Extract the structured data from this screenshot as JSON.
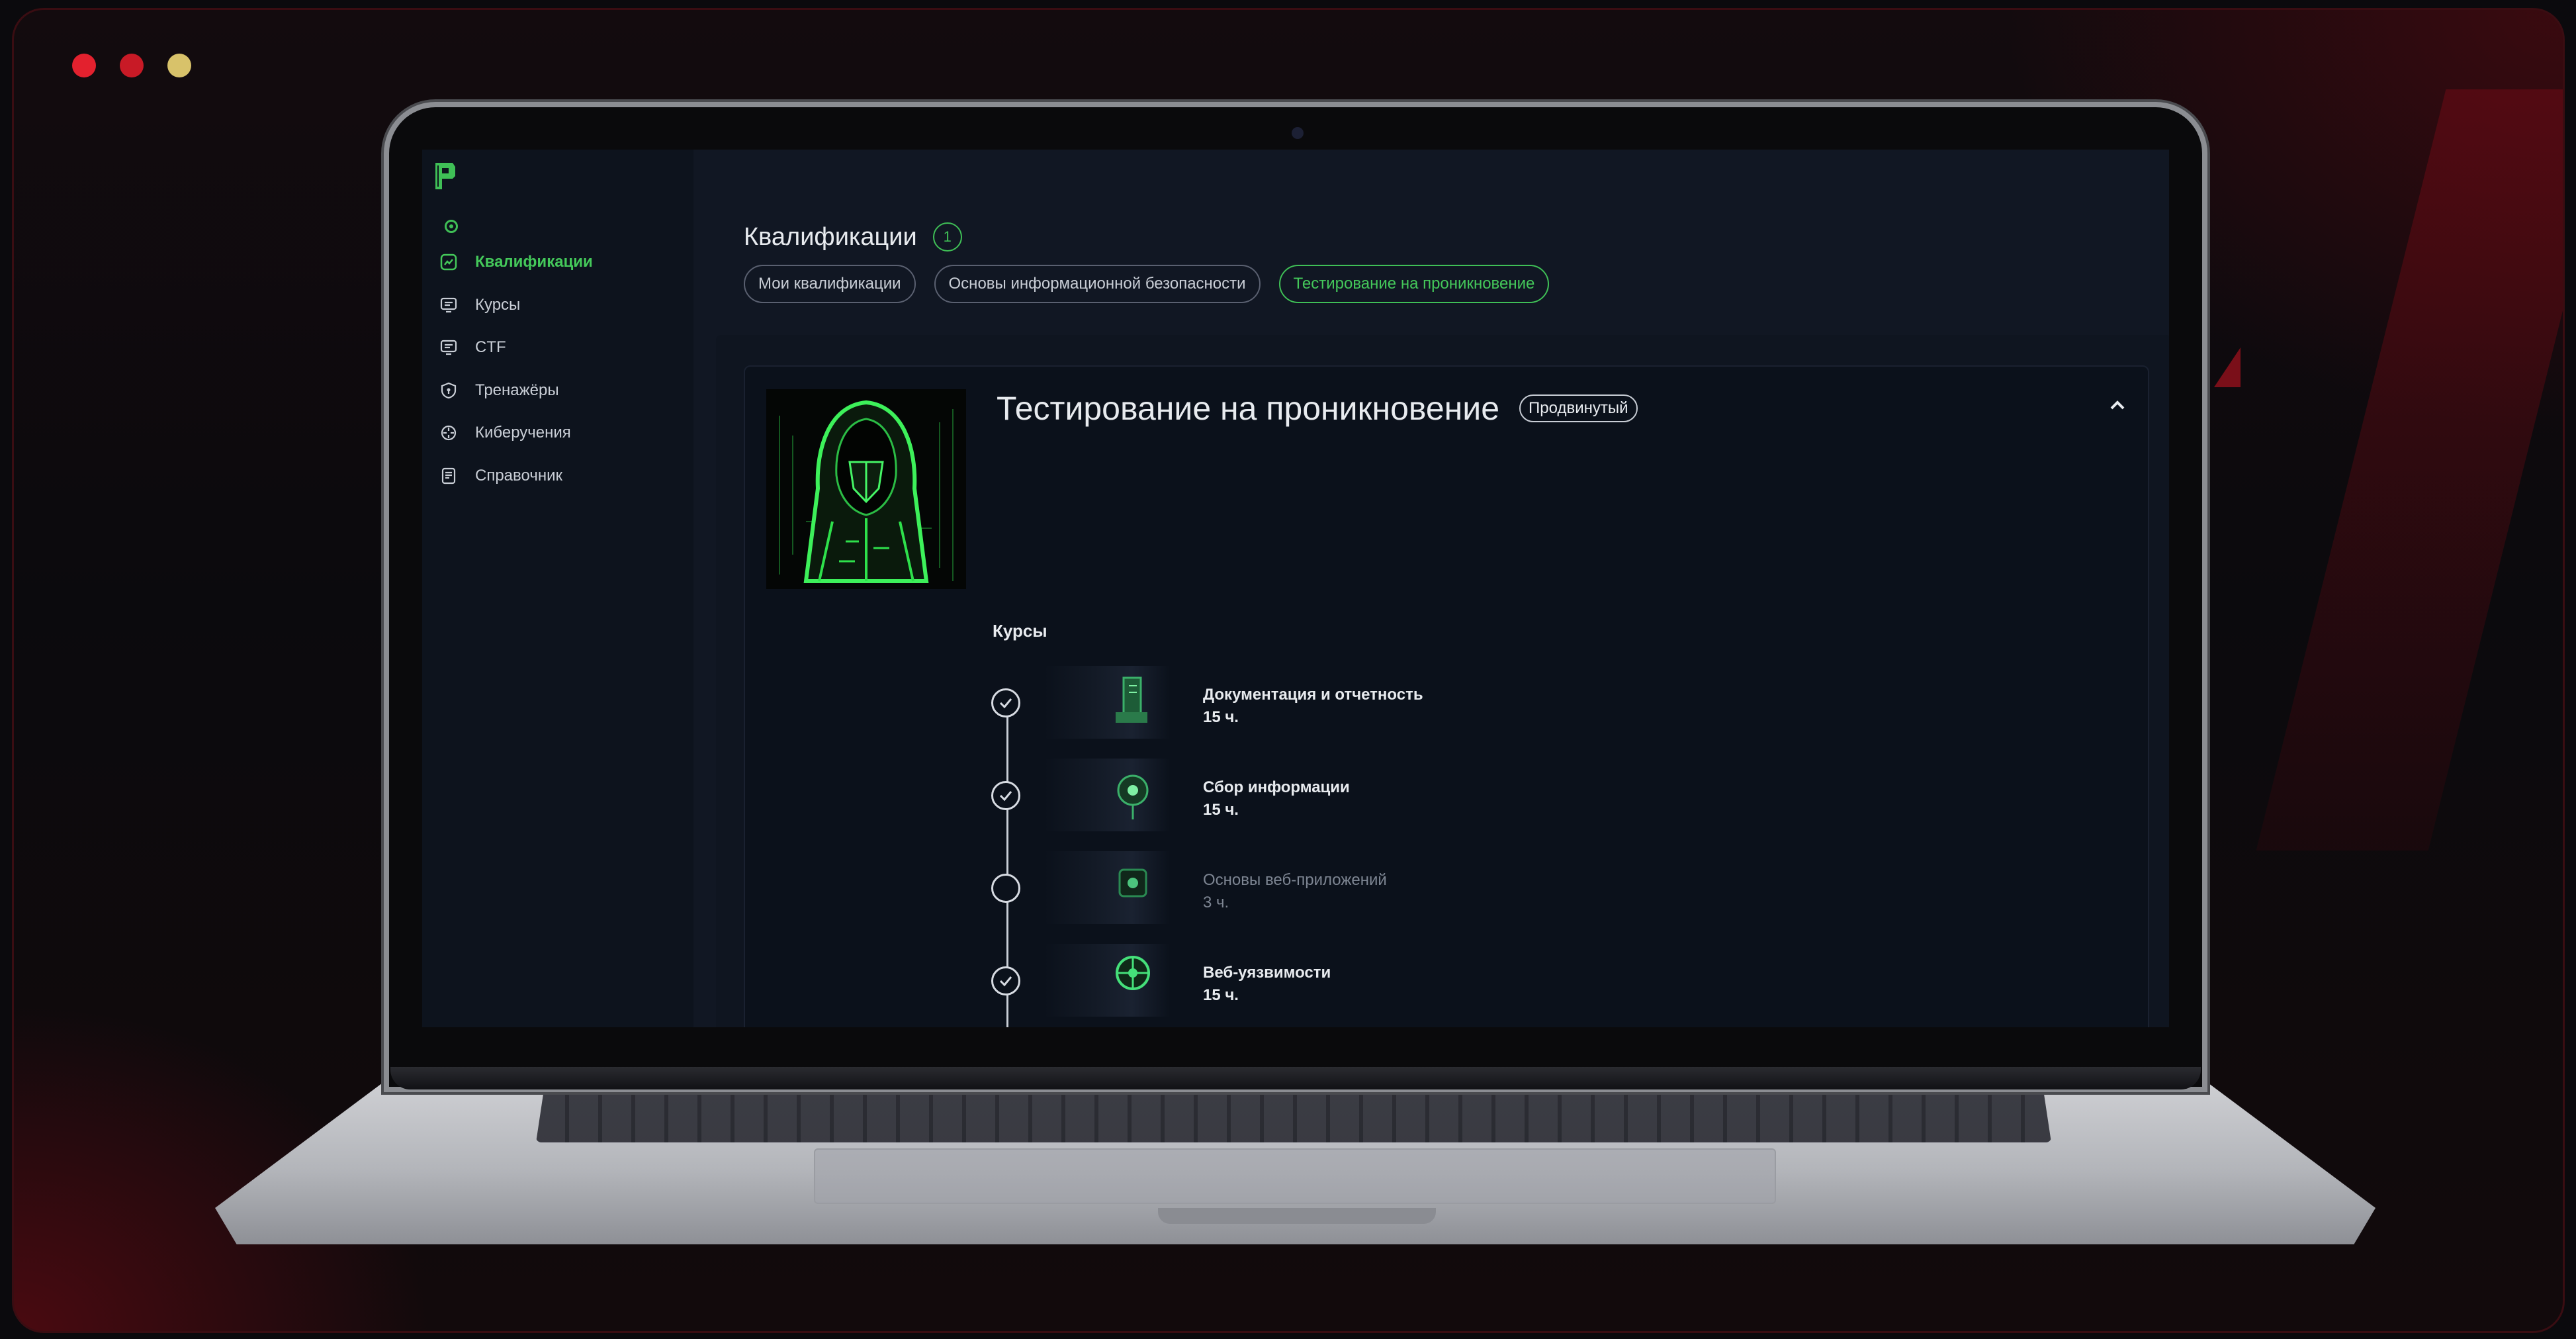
{
  "window": {
    "dots": [
      {
        "color": "#e3212e"
      },
      {
        "color": "#c81a26"
      },
      {
        "color": "#d8c26a"
      }
    ]
  },
  "colors": {
    "accent": "#3fbf56",
    "background": "#0b0a0d",
    "app_bg": "#111723",
    "sidebar_bg": "#0d131d"
  },
  "sidebar": {
    "logo_icon": "platform-logo-icon",
    "status_icon": "online-status-icon",
    "items": [
      {
        "label": "Квалификации",
        "icon": "qualifications-icon",
        "active": true
      },
      {
        "label": "Курсы",
        "icon": "courses-icon",
        "active": false
      },
      {
        "label": "CTF",
        "icon": "ctf-icon",
        "active": false
      },
      {
        "label": "Тренажёры",
        "icon": "shield-icon",
        "active": false
      },
      {
        "label": "Киберучения",
        "icon": "crosshair-icon",
        "active": false
      },
      {
        "label": "Справочник",
        "icon": "reference-book-icon",
        "active": false
      }
    ]
  },
  "main": {
    "title": "Квалификации",
    "count": "1",
    "tabs": [
      {
        "label": "Мои квалификации",
        "active": false
      },
      {
        "label": "Основы информационной безопасности",
        "active": false
      },
      {
        "label": "Тестирование на проникновение",
        "active": true
      }
    ],
    "qualification": {
      "title": "Тестирование на проникновение",
      "level": "Продвинутый",
      "collapse_icon": "chevron-up-icon",
      "cover_icon": "hooded-hacker-image",
      "courses_heading": "Курсы",
      "courses": [
        {
          "name": "Документация и отчетность",
          "hours": "15 ч.",
          "completed": true
        },
        {
          "name": "Сбор информации",
          "hours": "15 ч.",
          "completed": true
        },
        {
          "name": "Основы веб-приложений",
          "hours": "3 ч.",
          "completed": false
        },
        {
          "name": "Веб-уязвимости",
          "hours": "15 ч.",
          "completed": true
        }
      ]
    }
  }
}
